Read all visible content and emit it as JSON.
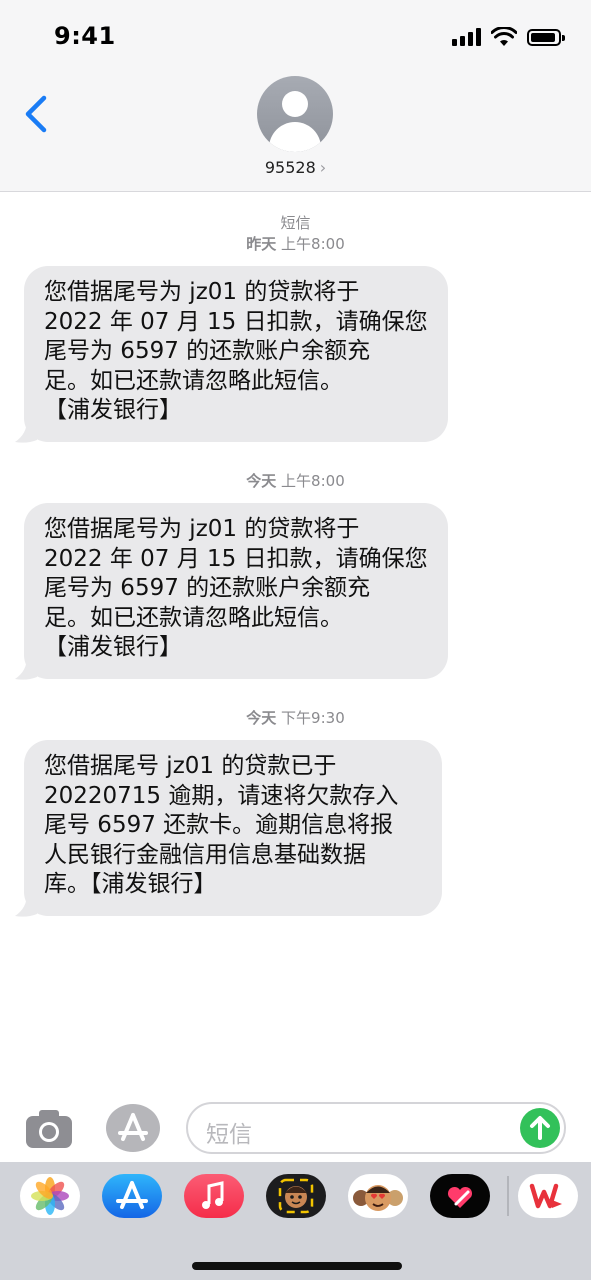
{
  "status": {
    "time": "9:41"
  },
  "header": {
    "contact": "95528",
    "chevron": "›",
    "back_icon": "chevron-left-icon"
  },
  "conversation": {
    "service_label": "短信",
    "messages": [
      {
        "day": "昨天",
        "time": "上午8:00",
        "text": "您借据尾号为 jz01 的贷款将于\n2022 年 07 月 15 日扣款，请确保您\n尾号为 6597 的还款账户余额充\n足。如已还款请忽略此短信。\n【浦发银行】"
      },
      {
        "day": "今天",
        "time": "上午8:00",
        "text": "您借据尾号为 jz01 的贷款将于\n2022 年 07 月 15 日扣款，请确保您\n尾号为 6597 的还款账户余额充\n足。如已还款请忽略此短信。\n【浦发银行】"
      },
      {
        "day": "今天",
        "time": "下午9:30",
        "text": "您借据尾号 jz01 的贷款已于\n20220715 逾期，请速将欠款存入\n尾号 6597 还款卡。逾期信息将报\n人民银行金融信用信息基础数据\n库。【浦发银行】"
      }
    ]
  },
  "input": {
    "placeholder": "短信"
  },
  "drawer": {
    "apps": [
      "photos-app-icon",
      "app-store-icon",
      "music-app-icon",
      "memoji-sticker-icon",
      "animoji-icon",
      "digital-touch-icon",
      "wps-app-icon"
    ]
  },
  "colors": {
    "bubble": "#e9e9eb",
    "accent_blue": "#1a7cf5",
    "send_green": "#32c15a"
  }
}
